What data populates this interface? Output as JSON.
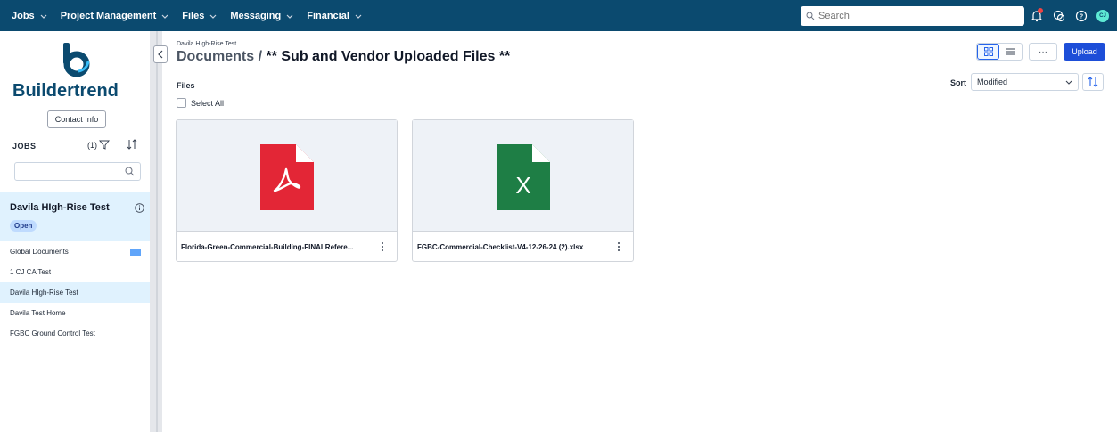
{
  "topnav": {
    "items": [
      {
        "label": "Jobs"
      },
      {
        "label": "Project Management"
      },
      {
        "label": "Files"
      },
      {
        "label": "Messaging"
      },
      {
        "label": "Financial"
      }
    ],
    "search_placeholder": "Search",
    "avatar_initials": "CJ",
    "bar_color": "#0b4a6f"
  },
  "sidebar": {
    "brand": "Buildertrend",
    "contact_label": "Contact Info",
    "jobs_label": "JOBS",
    "filter_count": "(1)",
    "active_job": {
      "name": "Davila HIgh-Rise Test",
      "status": "Open"
    },
    "jobs": [
      {
        "label": "Global Documents"
      },
      {
        "label": "1 CJ CA Test"
      },
      {
        "label": "Davila HIgh-Rise Test"
      },
      {
        "label": "Davila Test Home"
      },
      {
        "label": "FGBC Ground Control Test"
      }
    ]
  },
  "main": {
    "breadcrumb_job": "Davila HIgh-Rise Test",
    "title_root": "Documents",
    "title_sep": " / ",
    "title_folder": "** Sub and Vendor Uploaded Files **",
    "more_label": "···",
    "upload_label": "Upload",
    "files_label": "Files",
    "select_all_label": "Select All",
    "sort_label": "Sort",
    "sort_value": "Modified",
    "files": [
      {
        "name": "Florida-Green-Commercial-Building-FINALRefere...",
        "type": "pdf-icon",
        "color": "#e32636"
      },
      {
        "name": "FGBC-Commercial-Checklist-V4-12-26-24 (2).xlsx",
        "type": "excel-icon",
        "color": "#1e7e45"
      }
    ],
    "accent": "#1d4ed8"
  }
}
